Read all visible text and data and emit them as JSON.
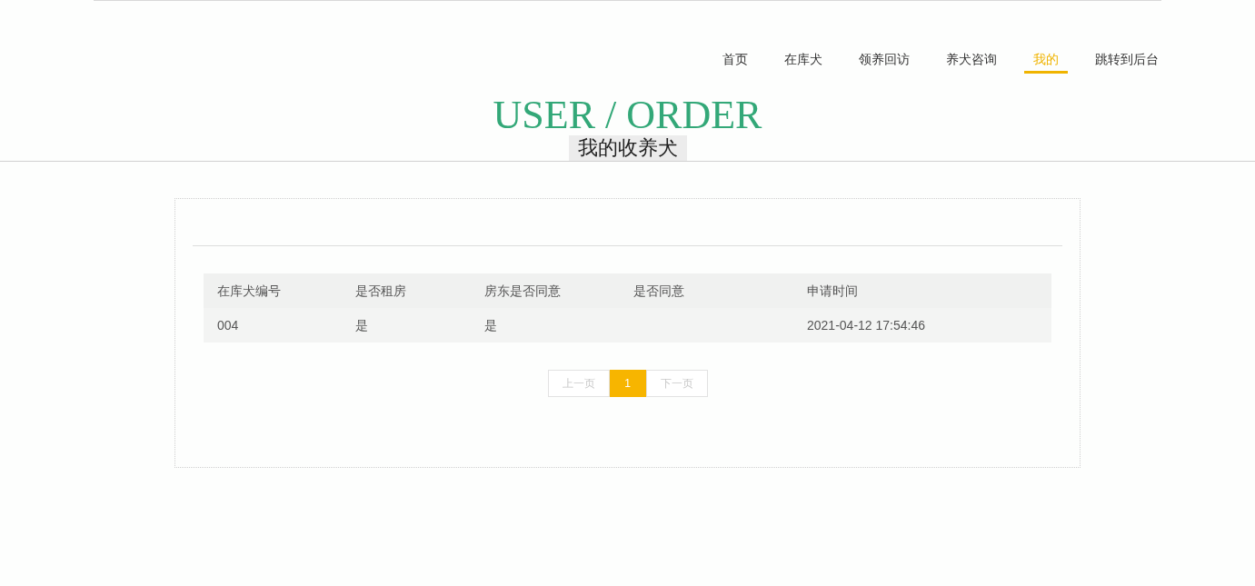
{
  "nav": [
    {
      "label": "首页",
      "selected": false
    },
    {
      "label": "在库犬",
      "selected": false
    },
    {
      "label": "领养回访",
      "selected": false
    },
    {
      "label": "养犬咨询",
      "selected": false
    },
    {
      "label": "我的",
      "selected": true
    },
    {
      "label": "跳转到后台",
      "selected": false
    }
  ],
  "heading": {
    "title": "USER / ORDER",
    "subtitle": "我的收养犬"
  },
  "table": {
    "columns": [
      "在库犬编号",
      "是否租房",
      "房东是否同意",
      "是否同意",
      "申请时间"
    ],
    "rows": [
      [
        "004",
        "是",
        "是",
        "",
        "2021-04-12 17:54:46"
      ]
    ]
  },
  "pagination": {
    "prev": "上一页",
    "pages": [
      {
        "label": "1",
        "selected": true
      }
    ],
    "next": "下一页"
  }
}
